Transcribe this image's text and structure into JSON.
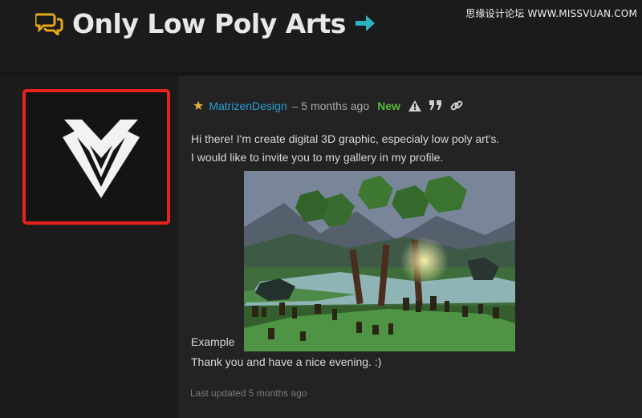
{
  "watermark": "思缘设计论坛 WWW.MISSVUAN.COM",
  "thread": {
    "title": "Only Low Poly Arts"
  },
  "post": {
    "author": "MatrizenDesign",
    "time": "– 5 months ago",
    "badge": "New",
    "line1": "Hi there! I'm create digital 3D graphic, especialy low poly art's.",
    "line2": "I would like to invite you to my gallery in my profile.",
    "caption": "Example",
    "thanks": "Thank you and have a nice evening. :)",
    "updated": "Last updated 5 months ago"
  },
  "colors": {
    "accent": "#2a9fd6",
    "chat_icon": "#e6a817",
    "arrow_icon": "#2bb3c0",
    "highlight_border": "#e8231f",
    "new_badge": "#58b93a"
  },
  "icons": [
    "chat-bubbles-icon",
    "arrow-right-icon",
    "star-icon",
    "warning-icon",
    "quote-icon",
    "link-icon"
  ]
}
